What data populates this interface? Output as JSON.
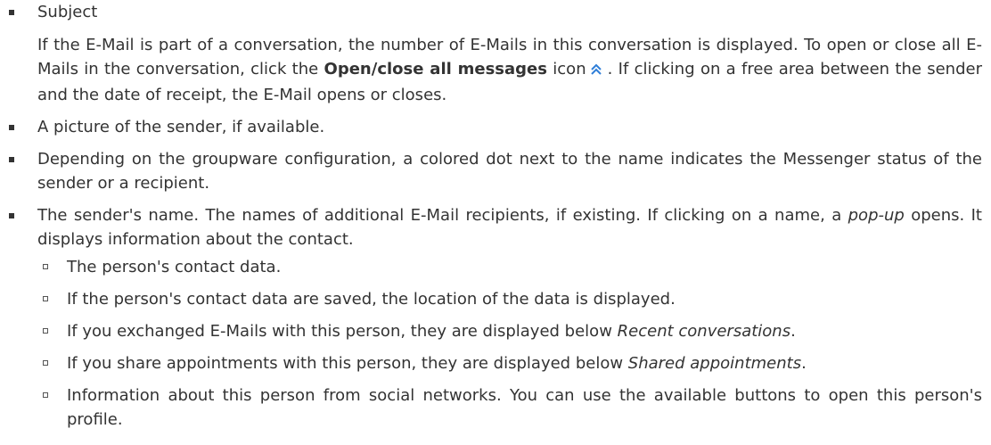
{
  "items": [
    {
      "text": "Subject",
      "para": {
        "t1": "If the E-Mail is part of a conversation, the number of E-Mails in this conversation is displayed. To open or close all E-Mails in the conversation, click the ",
        "bold": "Open/close all messages",
        "t2": " icon",
        "t3": ". If clicking on a free area between the sender and the date of receipt, the E-Mail opens or closes."
      }
    },
    {
      "text": "A picture of the sender, if available."
    },
    {
      "text": "Depending on the groupware configuration, a colored dot next to the name indicates the Mes­senger status of the sender or a recipient."
    },
    {
      "t1": "The sender's name. The names of additional E-Mail recipients, if existing. If clicking on a name, a ",
      "em": "pop-up",
      "t2": " opens. It displays information about the contact.",
      "subitems": [
        {
          "text": "The person's contact data."
        },
        {
          "text": "If the person's contact data are saved, the location of the data is displayed."
        },
        {
          "t1": "If you exchanged E-Mails with this person, they are displayed below ",
          "em": "Recent conversations",
          "t2": "."
        },
        {
          "t1": "If you share appointments with this person, they are displayed below ",
          "em": "Shared appointments",
          "t2": "."
        },
        {
          "text": "Information about this person from social networks. You can use the available buttons to open this person's profile."
        }
      ]
    }
  ],
  "icon_name": "double-chevron-up-icon",
  "colors": {
    "text": "#333333",
    "icon_accent": "#2f7ed8"
  }
}
